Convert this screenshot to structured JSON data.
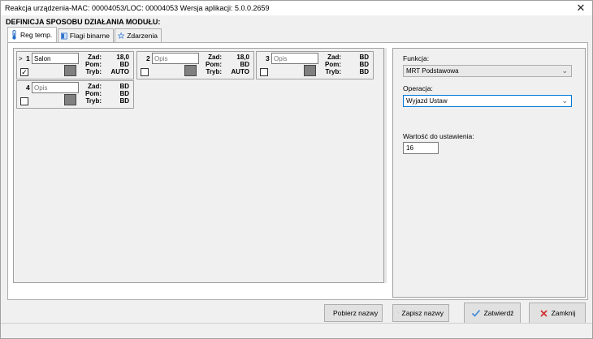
{
  "window": {
    "title": "Reakcja urządzenia-MAC: 00004053/LOC: 00004053 Wersja aplikacji: 5.0.0.2659",
    "close_glyph": "✕"
  },
  "section_title": "DEFINICJA SPOSOBU DZIAŁANIA MODUŁU:",
  "tabs": [
    {
      "label": "Reg temp.",
      "icon": "thermometer-icon",
      "active": true
    },
    {
      "label": "Flagi binarne",
      "icon": "flag-panel-icon",
      "active": false
    },
    {
      "label": "Zdarzenia",
      "icon": "star-icon",
      "active": false
    }
  ],
  "cards": [
    {
      "selector": ">",
      "number": "1",
      "name": "Salon",
      "name_is_placeholder": false,
      "checked": true,
      "labels": [
        "Zad:",
        "Pom:",
        "Tryb:"
      ],
      "values": [
        "18,0",
        "BD",
        "AUTO"
      ]
    },
    {
      "selector": "",
      "number": "2",
      "name": "Opis",
      "name_is_placeholder": true,
      "checked": false,
      "labels": [
        "Zad:",
        "Pom:",
        "Tryb:"
      ],
      "values": [
        "18,0",
        "BD",
        "AUTO"
      ]
    },
    {
      "selector": "",
      "number": "3",
      "name": "Opis",
      "name_is_placeholder": true,
      "checked": false,
      "labels": [
        "Zad:",
        "Pom:",
        "Tryb:"
      ],
      "values": [
        "BD",
        "BD",
        "BD"
      ]
    },
    {
      "selector": "",
      "number": "4",
      "name": "Opis",
      "name_is_placeholder": true,
      "checked": false,
      "labels": [
        "Zad:",
        "Pom:",
        "Tryb:"
      ],
      "values": [
        "BD",
        "BD",
        "BD"
      ]
    }
  ],
  "right": {
    "funkcja_label": "Funkcja:",
    "funkcja_value": "MRT Podstawowa",
    "operacja_label": "Operacja:",
    "operacja_value": "Wyjazd Ustaw",
    "wartosc_label": "Wartość do ustawienia:",
    "wartosc_value": "16"
  },
  "buttons": {
    "pobierz": "Pobierz nazwy",
    "zapisz": "Zapisz nazwy",
    "zatwierdz": "Zatwierdź",
    "zamknij": "Zamknij"
  },
  "colors": {
    "accent": "#0078d7",
    "swatch": "#808080",
    "confirm_check": "#3a88d8",
    "cancel_x": "#d23030"
  }
}
